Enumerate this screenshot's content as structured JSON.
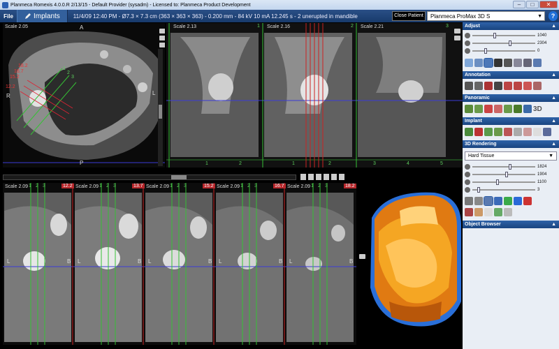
{
  "window": {
    "title": "Planmeca Romexis 4.0.0.R  2/13/15 - Default Provider (sysadm) - Licensed to: Planmeca Product Development"
  },
  "toolbar": {
    "file_label": "File",
    "tab_label": "Implants",
    "scan_info": "11/4/09 12:40 PM - Ø7.3 × 7.3 cm (363 × 363 × 363) - 0.200 mm - 84 kV 10 mA 12.245 s -  2 unerupted in mandible",
    "close_patient_label": "Close Patient",
    "device_selected": "Planmeca ProMax 3D S",
    "help_label": "?"
  },
  "views": {
    "axial": {
      "scale": "Scale 2.05",
      "top": "A",
      "left": "R",
      "right": "L",
      "bottom": "P",
      "markers": [
        "18.2",
        "16.7",
        "15.2",
        "12.2"
      ],
      "slice_nums": [
        "1",
        "2",
        "3"
      ]
    },
    "cross": [
      {
        "scale": "Scale 2.13",
        "num": "1"
      },
      {
        "scale": "Scale 2.16",
        "num": "2"
      },
      {
        "scale": "Scale 2.21",
        "num": "3"
      }
    ],
    "cross_ruler": [
      "1",
      "2",
      "1",
      "2",
      "3",
      "4",
      "5"
    ],
    "slices": [
      {
        "scale": "Scale 2.09",
        "pos": "12.2",
        "nums": [
          "1",
          "2",
          "3"
        ],
        "left": "L",
        "right": "B"
      },
      {
        "scale": "Scale 2.09",
        "pos": "13.7",
        "nums": [
          "1",
          "2",
          "3"
        ],
        "left": "L",
        "right": "B"
      },
      {
        "scale": "Scale 2.09",
        "pos": "15.2",
        "nums": [
          "1",
          "2",
          "3"
        ],
        "left": "L",
        "right": "B"
      },
      {
        "scale": "Scale 2.09",
        "pos": "16.7",
        "nums": [
          "1",
          "2",
          "3"
        ],
        "left": "L",
        "right": "B"
      },
      {
        "scale": "Scale 2.09",
        "pos": "18.2",
        "nums": [
          "1",
          "2",
          "3"
        ],
        "left": "L",
        "right": "B"
      }
    ]
  },
  "panel": {
    "adjust": {
      "title": "Adjust",
      "sliders": [
        {
          "icon": "brightness-icon",
          "value": "1040",
          "level": 0.35
        },
        {
          "icon": "contrast-icon",
          "value": "2304",
          "level": 0.6
        },
        {
          "icon": "gamma-icon",
          "value": "0",
          "level": 0.2
        }
      ]
    },
    "annotation": {
      "title": "Annotation"
    },
    "panoramic": {
      "title": "Panoramic",
      "label_3d": "3D"
    },
    "implant": {
      "title": "Implant"
    },
    "rendering": {
      "title": "3D Rendering",
      "preset": "Hard Tissue",
      "sliders": [
        {
          "icon": "brightness-icon",
          "value": "1824",
          "level": 0.6
        },
        {
          "icon": "contrast-icon",
          "value": "1904",
          "level": 0.55
        },
        {
          "icon": "opacity-icon",
          "value": "1100",
          "level": 0.4
        },
        {
          "icon": "gamma-icon",
          "value": "3",
          "level": 0.08
        }
      ]
    },
    "object_browser": {
      "title": "Object Browser"
    }
  },
  "colors": {
    "accent": "#1a4580",
    "marker_red": "#b5262a",
    "guide_green": "#35c135",
    "guide_blue": "#3b3bd6"
  }
}
